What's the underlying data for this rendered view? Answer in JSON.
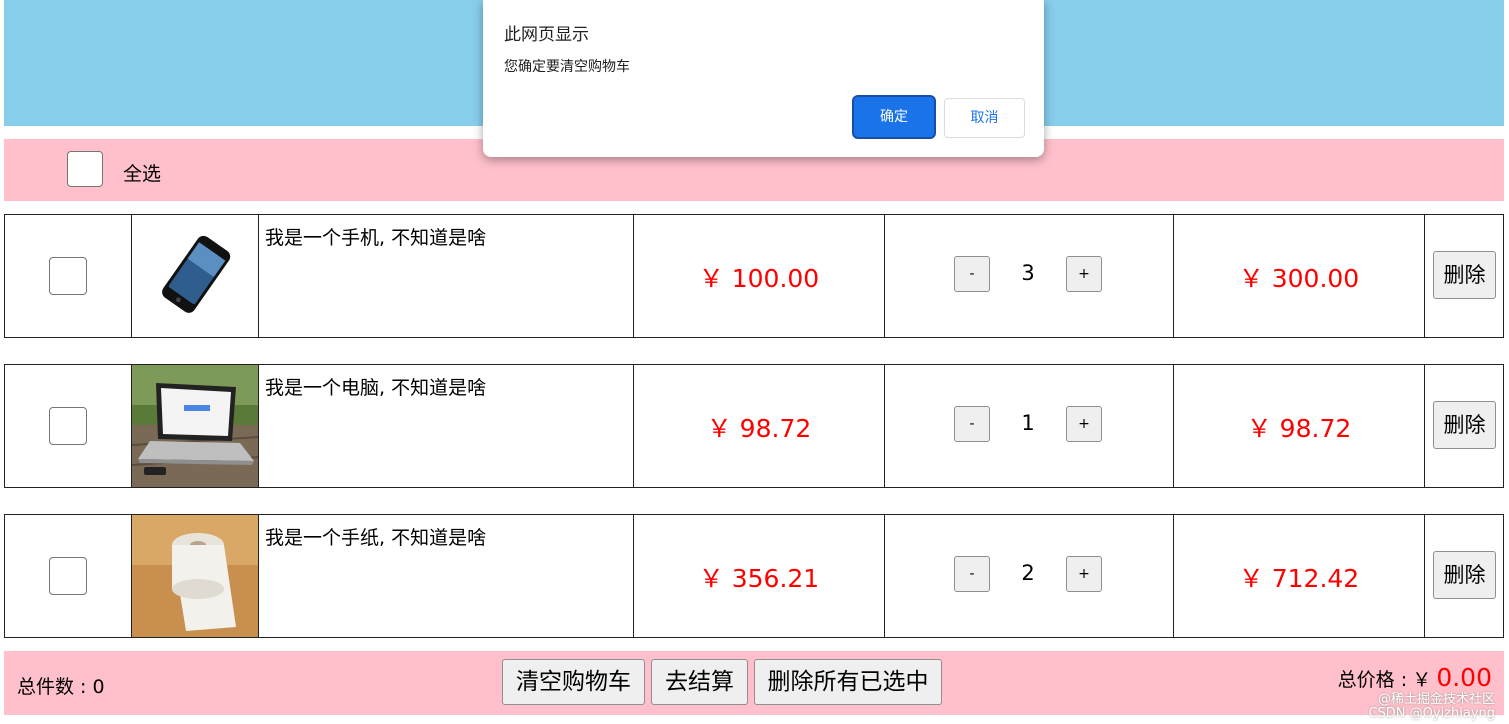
{
  "select_all": {
    "label": "全选",
    "checked": false
  },
  "items": [
    {
      "name": "我是一个手机, 不知道是啥",
      "unit_price": "￥ 100.00",
      "quantity": "3",
      "subtotal": "￥ 300.00",
      "delete_label": "删除",
      "image_icon": "phone-image",
      "checked": false
    },
    {
      "name": "我是一个电脑, 不知道是啥",
      "unit_price": "￥ 98.72",
      "quantity": "1",
      "subtotal": "￥ 98.72",
      "delete_label": "删除",
      "image_icon": "laptop-image",
      "checked": false
    },
    {
      "name": "我是一个手纸, 不知道是啥",
      "unit_price": "￥ 356.21",
      "quantity": "2",
      "subtotal": "￥ 712.42",
      "delete_label": "删除",
      "image_icon": "toilet-paper-image",
      "checked": false
    }
  ],
  "quantity_controls": {
    "minus": "-",
    "plus": "+"
  },
  "footer": {
    "total_count": "总件数 : 0",
    "clear_cart": "清空购物车",
    "checkout": "去结算",
    "delete_selected": "删除所有已选中",
    "total_price_label": "总价格 :",
    "currency": "￥",
    "total_price": "0.00"
  },
  "watermark": {
    "line1": "@稀土掘金技术社区",
    "line2": "CSDN @Oyizhiayng"
  },
  "dialog": {
    "title": "此网页显示",
    "message": "您确定要清空购物车",
    "ok": "确定",
    "cancel": "取消"
  },
  "colors": {
    "banner": "#87ceeb",
    "bar": "#ffc0cb",
    "price": "#ff0000",
    "dialog_ok": "#1a73e8"
  }
}
